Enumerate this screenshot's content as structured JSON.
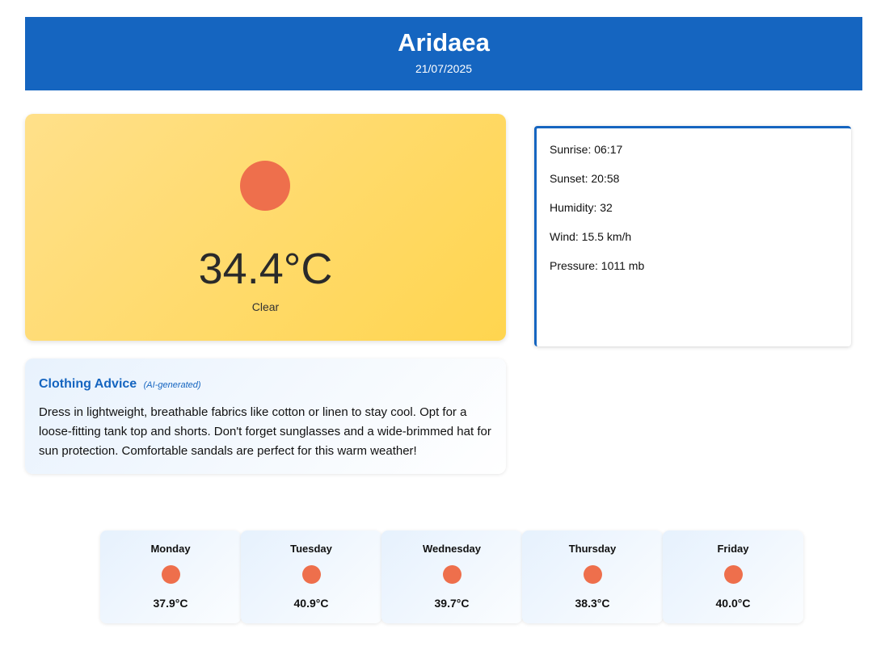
{
  "header": {
    "city": "Aridaea",
    "date": "21/07/2025"
  },
  "current": {
    "icon": "sun-icon",
    "icon_color": "#ee6f4c",
    "temperature": "34.4°C",
    "condition": "Clear"
  },
  "details": {
    "sunrise": "Sunrise: 06:17",
    "sunset": "Sunset: 20:58",
    "humidity": "Humidity: 32",
    "wind": "Wind: 15.5 km/h",
    "pressure": "Pressure: 1011 mb"
  },
  "advice": {
    "title": "Clothing Advice",
    "tag": "(AI-generated)",
    "text": "Dress in lightweight, breathable fabrics like cotton or linen to stay cool. Opt for a loose-fitting tank top and shorts. Don't forget sunglasses and a wide-brimmed hat for sun protection. Comfortable sandals are perfect for this warm weather!"
  },
  "forecast": [
    {
      "day": "Monday",
      "temp": "37.9°C",
      "icon": "sun-icon"
    },
    {
      "day": "Tuesday",
      "temp": "40.9°C",
      "icon": "sun-icon"
    },
    {
      "day": "Wednesday",
      "temp": "39.7°C",
      "icon": "sun-icon"
    },
    {
      "day": "Thursday",
      "temp": "38.3°C",
      "icon": "sun-icon"
    },
    {
      "day": "Friday",
      "temp": "40.0°C",
      "icon": "sun-icon"
    }
  ],
  "colors": {
    "brand_blue": "#1565c0",
    "sun_orange": "#ee6f4c",
    "card_yellow": "#ffd54f"
  }
}
